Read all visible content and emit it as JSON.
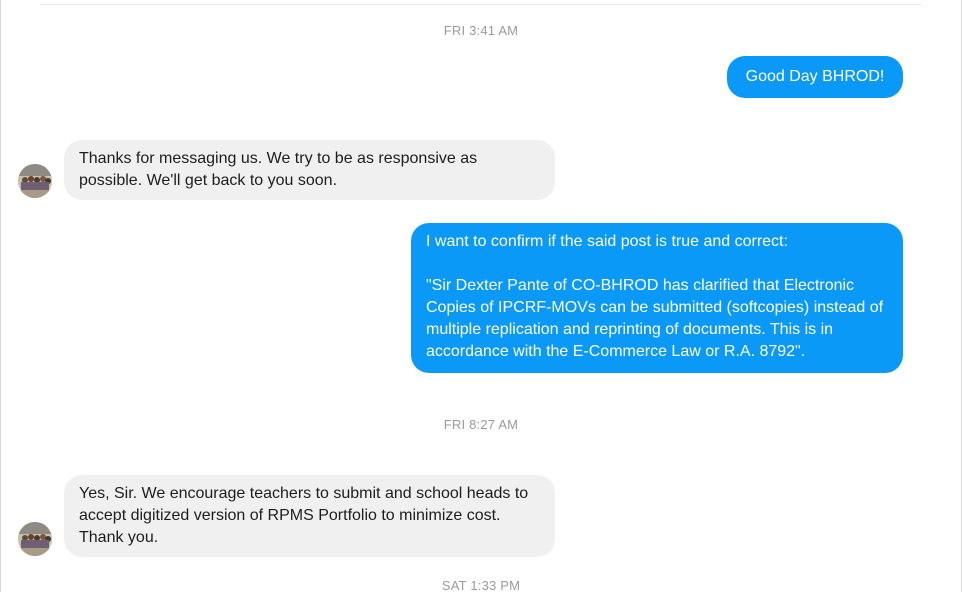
{
  "conversation": {
    "timestamps": {
      "t1": "FRI 3:41 AM",
      "t2": "FRI 8:27 AM",
      "t3": "SAT 1:33 PM"
    },
    "messages": {
      "m1": "Good Day BHROD!",
      "m2": "Thanks for messaging us. We try to be as responsive as possible. We'll get back to you soon.",
      "m3": "I want to confirm if the said post is true and correct:\n\n\"Sir Dexter Pante of CO-BHROD has clarified that Electronic Copies of IPCRF-MOVs can be submitted (softcopies) instead of multiple replication and reprinting of documents. This is in accordance with the E-Commerce Law or R.A. 8792\".",
      "m4": "Yes, Sir. We encourage teachers to submit and school heads to accept digitized version of RPMS Portfolio to minimize cost. Thank you."
    },
    "avatar_icon": "group-photo-avatar-icon",
    "colors": {
      "outgoing_bubble": "#0a99f7",
      "incoming_bubble": "#f1f0f0",
      "timestamp_text": "#9a9a9a"
    }
  }
}
